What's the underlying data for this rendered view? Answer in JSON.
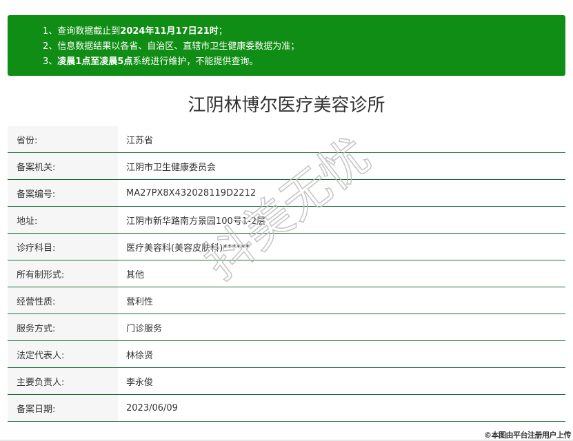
{
  "notice": {
    "line1": {
      "prefix": "1、查询数据截止到",
      "date": "2024年11月17日21时",
      "suffix": "；"
    },
    "line2": "2、信息数据结果以各省、自治区、直辖市卫生健康委数据为准；",
    "line3": {
      "prefix": "3、",
      "bold": "凌晨1点至凌晨5点",
      "suffix": "系统进行维护，不能提供查询。"
    }
  },
  "title": "江阴林博尔医疗美容诊所",
  "rows": [
    {
      "label": "省份:",
      "value": "江苏省"
    },
    {
      "label": "备案机关:",
      "value": "江阴市卫生健康委员会"
    },
    {
      "label": "备案编号:",
      "value": "MA27PX8X432028119D2212"
    },
    {
      "label": "地址:",
      "value": "江阴市新华路南方景园100号1-2层"
    },
    {
      "label": "诊疗科目:",
      "value": "医疗美容科(美容皮肤科)******"
    },
    {
      "label": "所有制形式:",
      "value": "其他"
    },
    {
      "label": "经营性质:",
      "value": "营利性"
    },
    {
      "label": "服务方式:",
      "value": "门诊服务"
    },
    {
      "label": "法定代表人:",
      "value": "林徐贤"
    },
    {
      "label": "主要负责人:",
      "value": "李永俊"
    },
    {
      "label": "备案日期:",
      "value": "2023/06/09"
    }
  ],
  "watermark": "抖美无忧",
  "credit": "©本图由平台注册用户上传",
  "colors": {
    "notice_bg": "#108d14",
    "row_border": "#1b6c37",
    "label_bg": "#f6f6f6"
  }
}
